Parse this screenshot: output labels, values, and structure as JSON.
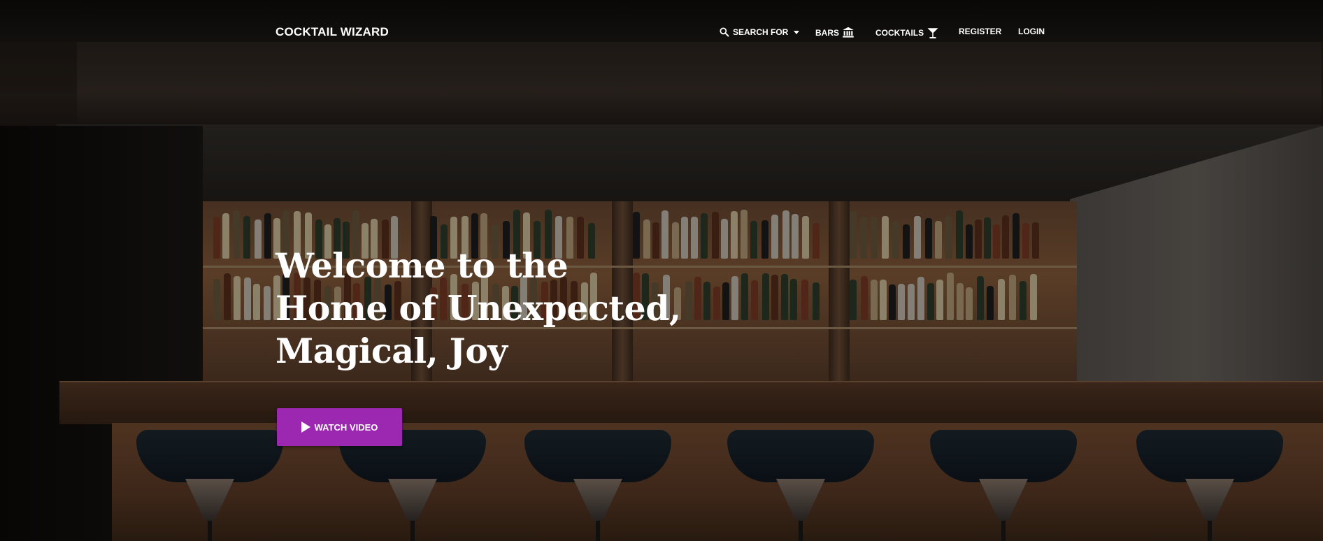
{
  "brand": {
    "name": "COCKTAIL WIZARD"
  },
  "nav": {
    "items": [
      {
        "label": "SEARCH FOR",
        "icon": "search-icon",
        "dropdown": true
      },
      {
        "label": "BARS",
        "icon": "bank-icon"
      },
      {
        "label": "COCKTAILS",
        "icon": "martini-glass-icon"
      },
      {
        "label": "REGISTER"
      },
      {
        "label": "LOGIN"
      }
    ]
  },
  "hero": {
    "headline_lines": [
      "Welcome to the",
      "Home of Unexpected,",
      "Magical, Joy"
    ],
    "cta_label": "WATCH VIDEO",
    "cta_icon": "play-icon",
    "cta_color": "#9c27b0"
  }
}
